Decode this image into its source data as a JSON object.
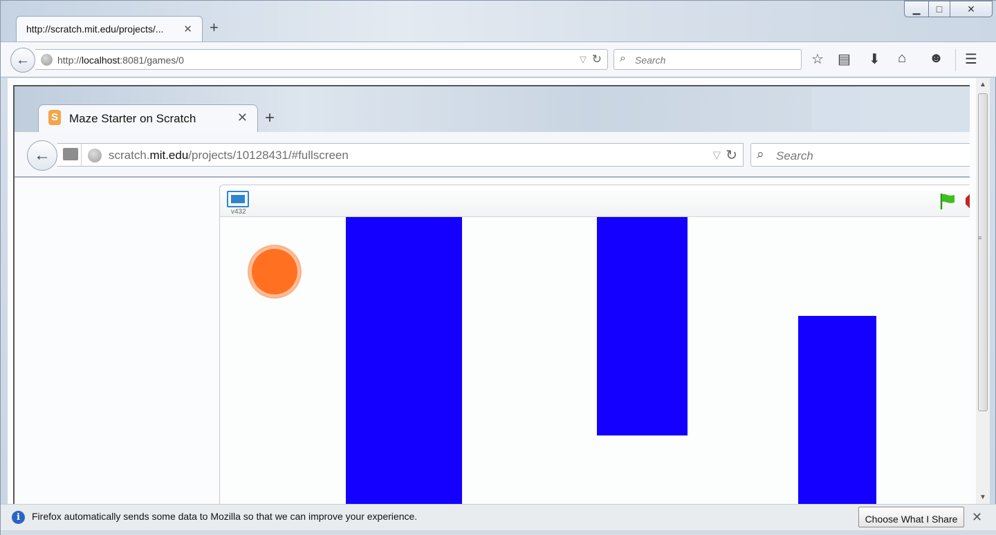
{
  "outer": {
    "tab_title": "http://scratch.mit.edu/projects/...",
    "url_prefix": "http://",
    "url_host": "localhost",
    "url_rest": ":8081/games/0",
    "search_placeholder": "Search"
  },
  "inner": {
    "tab_title": "Maze Starter on Scratch",
    "url_pre": "scratch.",
    "url_host": "mit.edu",
    "url_rest": "/projects/10128431/#fullscreen",
    "search_placeholder": "Search",
    "favicon_letter": "S"
  },
  "player": {
    "version": "v432",
    "colors": {
      "wall": "#1400ff",
      "ball": "#ff7120",
      "flag": "#3fbf1f",
      "stop": "#c22525"
    }
  },
  "notification": {
    "message": "Firefox automatically sends some data to Mozilla so that we can improve your experience.",
    "button": "Choose What I Share"
  },
  "icons": [
    "back-arrow-icon",
    "globe-icon",
    "reload-icon",
    "search-icon",
    "star-icon",
    "reading-list-icon",
    "download-icon",
    "home-icon",
    "chat-icon",
    "menu-icon",
    "green-flag-icon",
    "stop-icon",
    "fullscreen-icon",
    "info-icon",
    "close-icon"
  ]
}
